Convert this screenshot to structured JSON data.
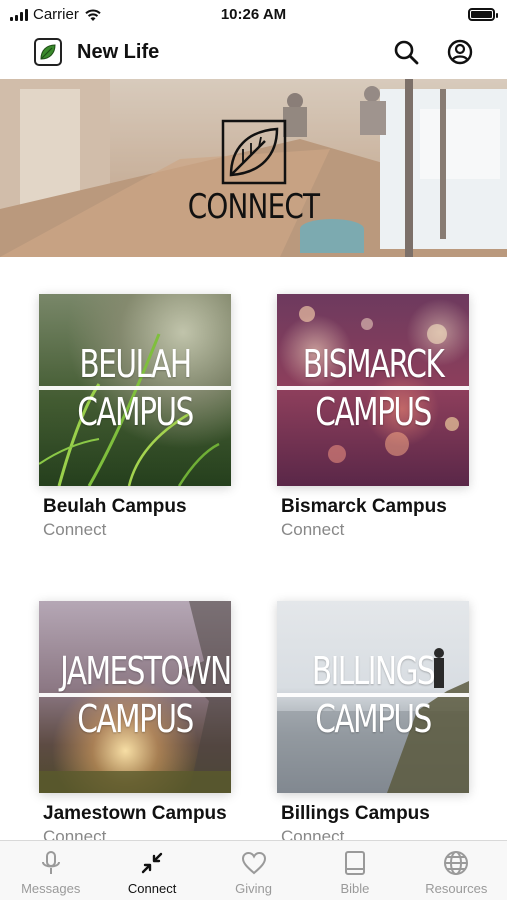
{
  "status_bar": {
    "carrier": "Carrier",
    "time": "10:26 AM"
  },
  "header": {
    "title": "New Life"
  },
  "hero": {
    "title": "CONNECT"
  },
  "campuses": [
    {
      "image_line1": "BEULAH",
      "image_line2": "CAMPUS",
      "title": "Beulah Campus",
      "subtitle": "Connect"
    },
    {
      "image_line1": "BISMARCK",
      "image_line2": "CAMPUS",
      "title": "Bismarck Campus",
      "subtitle": "Connect"
    },
    {
      "image_line1": "JAMESTOWN",
      "image_line2": "CAMPUS",
      "title": "Jamestown Campus",
      "subtitle": "Connect"
    },
    {
      "image_line1": "BILLINGS",
      "image_line2": "CAMPUS",
      "title": "Billings Campus",
      "subtitle": "Connect"
    }
  ],
  "tabs": [
    {
      "label": "Messages",
      "icon": "microphone-icon",
      "active": false
    },
    {
      "label": "Connect",
      "icon": "connect-arrows-icon",
      "active": true
    },
    {
      "label": "Giving",
      "icon": "heart-icon",
      "active": false
    },
    {
      "label": "Bible",
      "icon": "book-icon",
      "active": false
    },
    {
      "label": "Resources",
      "icon": "globe-icon",
      "active": false
    }
  ],
  "colors": {
    "brand_leaf": "#3a8a2c",
    "tab_inactive": "#9a9a9a",
    "tab_active": "#111111"
  }
}
